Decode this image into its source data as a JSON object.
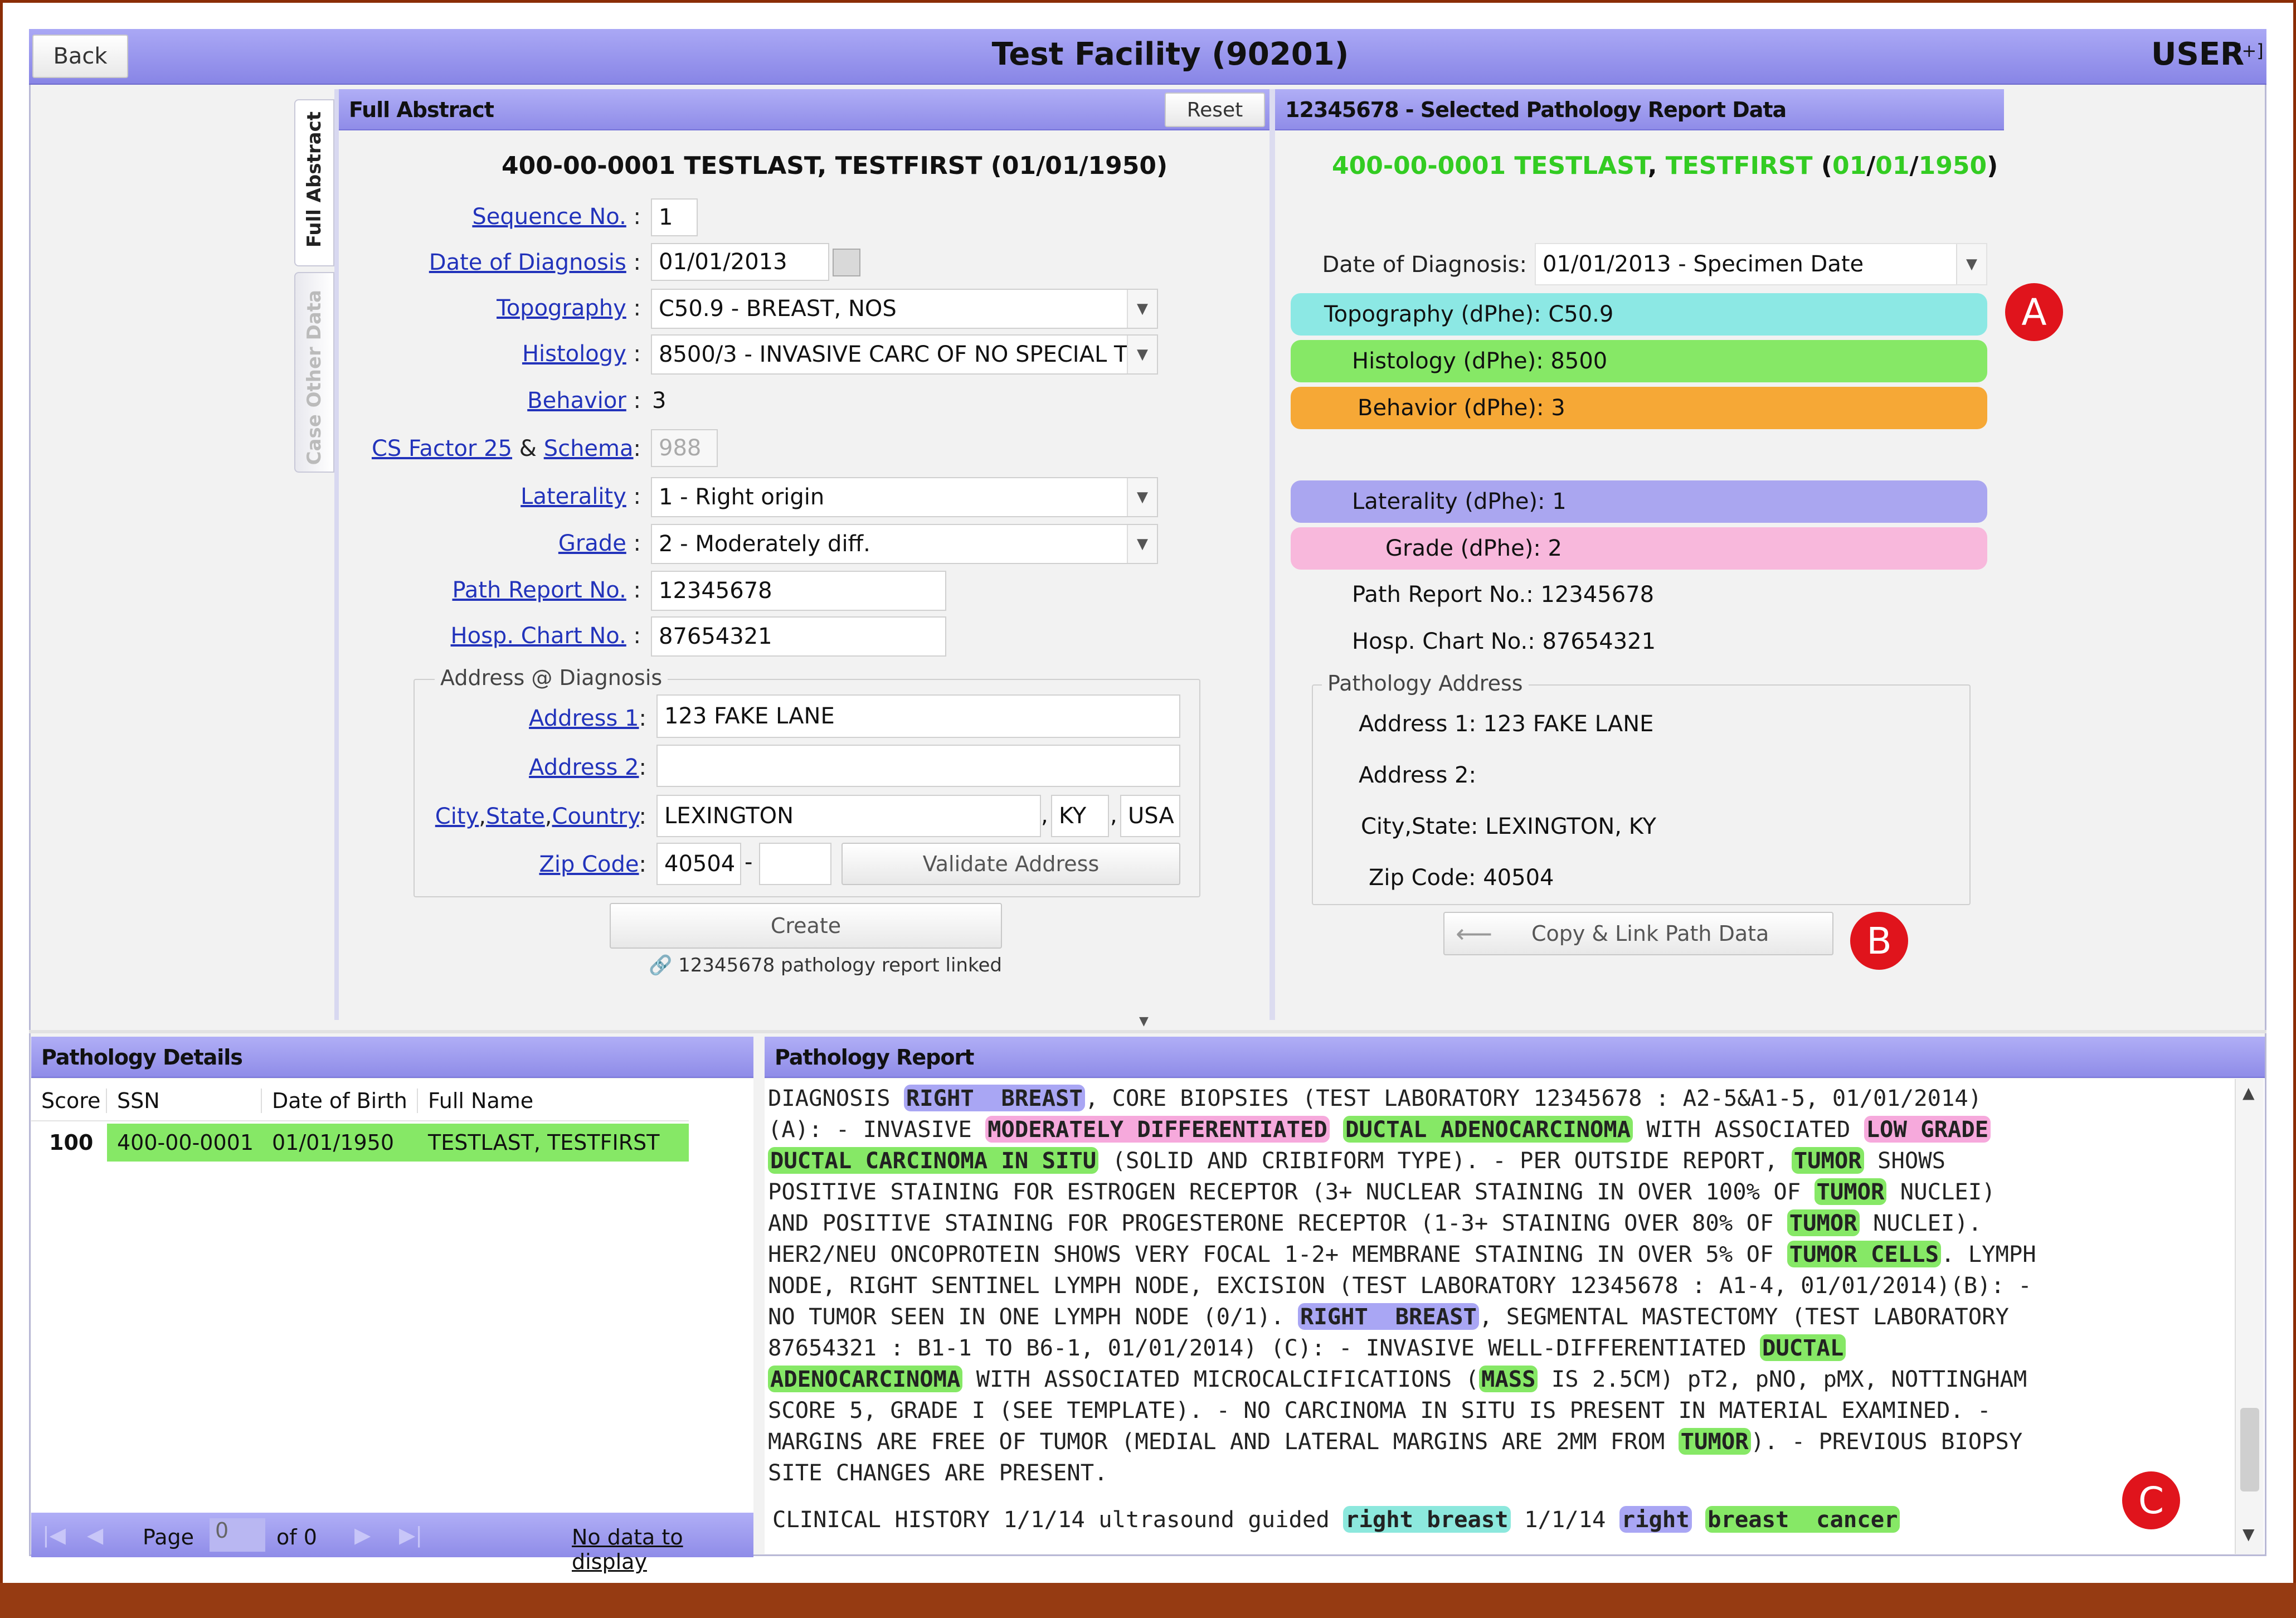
{
  "header": {
    "back_label": "Back",
    "title": "Test Facility (90201)",
    "user_label": "USER",
    "user_expand": "[+]"
  },
  "side_tabs": {
    "full_abstract": "Full Abstract",
    "case_other": "Case Other Data"
  },
  "abstract": {
    "title": "Full Abstract",
    "reset_label": "Reset",
    "patient": "400-00-0001 TESTLAST, TESTFIRST (01/01/1950)",
    "sequence_label": "Sequence No.",
    "sequence_value": "1",
    "dod_label": "Date of Diagnosis",
    "dod_value": "01/01/2013",
    "topo_label": "Topography",
    "topo_value": "C50.9 - BREAST, NOS",
    "hist_label": "Histology",
    "hist_value": "8500/3 - INVASIVE CARC OF NO SPECIAL T",
    "beh_label": "Behavior",
    "beh_value": "3",
    "csf_label": "CS Factor 25",
    "amp": "&",
    "schema_label": "Schema",
    "csf_value": "988",
    "lat_label": "Laterality",
    "lat_value": "1 - Right origin",
    "grade_label": "Grade",
    "grade_value": "2 - Moderately diff.",
    "path_label": "Path Report No.",
    "path_value": "12345678",
    "chart_label": "Hosp. Chart No.",
    "chart_value": "87654321",
    "addr_group": "Address @ Diagnosis",
    "addr1_label": "Address 1",
    "addr1_value": "123 FAKE LANE",
    "addr2_label": "Address 2",
    "addr2_value": "",
    "city_label_city": "City",
    "city_label_state": "State",
    "city_label_country": "Country",
    "city_value": "LEXINGTON",
    "state_value": "KY",
    "country_value": "USA",
    "zip_label": "Zip Code",
    "zip_value": "40504",
    "zip_ext": "",
    "validate_label": "Validate Address",
    "create_label": "Create",
    "linked_note": "12345678 pathology report linked",
    "colon": ":",
    "comma": ","
  },
  "selected": {
    "title": "12345678 - Selected Pathology Report Data",
    "id": "400-00-0001",
    "last": "TESTLAST",
    "first": "TESTFIRST",
    "dob_m": "01",
    "dob_d": "01",
    "dob_y": "1950",
    "dod_label": "Date of Diagnosis:",
    "dod_value": "01/01/2013 - Specimen Date",
    "topo": "Topography (dPhe): C50.9",
    "hist": "Histology (dPhe): 8500",
    "beh": "Behavior (dPhe): 3",
    "lat": "Laterality (dPhe): 1",
    "grade": "Grade (dPhe): 2",
    "path": "Path Report No.: 12345678",
    "chart": "Hosp. Chart No.: 87654321",
    "addr_group": "Pathology Address",
    "addr1": "Address 1: 123 FAKE LANE",
    "addr2": "Address 2:",
    "city": "City,State: LEXINGTON, KY",
    "zip": "Zip Code: 40504",
    "copy_label": "Copy & Link Path Data",
    "colors": {
      "cyan": "#8ce8e4",
      "green": "#86e866",
      "orange": "#f6a836",
      "purple": "#aaa6f0",
      "pink": "#f8b8dc"
    }
  },
  "markers": {
    "a": "A",
    "b": "B",
    "c": "C"
  },
  "details": {
    "title": "Pathology Details",
    "columns": [
      "Score",
      "SSN",
      "Date of Birth",
      "Full Name"
    ],
    "row": {
      "score": "100",
      "ssn": "400-00-0001",
      "dob": "01/01/1950",
      "name": "TESTLAST, TESTFIRST"
    },
    "page_label": "Page",
    "page_value": "0",
    "of_label": "of 0",
    "no_data": "No data to display"
  },
  "report": {
    "title": "Pathology Report",
    "segments": [
      [
        "DIAGNOSIS ",
        ""
      ],
      [
        "RIGHT  BREAST",
        "hb"
      ],
      [
        ", CORE BIOPSIES (TEST LABORATORY 12345678 : A2-5&A1-5, 01/01/2014)",
        ""
      ],
      [
        "\n",
        ""
      ],
      [
        "(A): - INVASIVE ",
        ""
      ],
      [
        "MODERATELY DIFFERENTIATED",
        "hp"
      ],
      [
        " ",
        ""
      ],
      [
        "DUCTAL ADENOCARCINOMA",
        "hg"
      ],
      [
        " WITH ASSOCIATED ",
        ""
      ],
      [
        "LOW GRADE",
        "hp"
      ],
      [
        "\n",
        ""
      ],
      [
        "DUCTAL CARCINOMA IN SITU",
        "hg"
      ],
      [
        " (SOLID AND CRIBIFORM TYPE). - PER OUTSIDE REPORT, ",
        ""
      ],
      [
        "TUMOR",
        "hg"
      ],
      [
        " SHOWS",
        ""
      ],
      [
        "\n",
        ""
      ],
      [
        "POSITIVE STAINING FOR ESTROGEN RECEPTOR (3+ NUCLEAR STAINING IN OVER 100% OF ",
        ""
      ],
      [
        "TUMOR",
        "hg"
      ],
      [
        " NUCLEI)",
        ""
      ],
      [
        "\n",
        ""
      ],
      [
        "AND POSITIVE STAINING FOR PROGESTERONE RECEPTOR (1-3+ STAINING OVER 80% OF ",
        ""
      ],
      [
        "TUMOR",
        "hg"
      ],
      [
        " NUCLEI).",
        ""
      ],
      [
        "\n",
        ""
      ],
      [
        "HER2/NEU ONCOPROTEIN SHOWS VERY FOCAL 1-2+ MEMBRANE STAINING IN OVER 5% OF ",
        ""
      ],
      [
        "TUMOR CELLS",
        "hg"
      ],
      [
        ". LYMPH",
        ""
      ],
      [
        "\n",
        ""
      ],
      [
        "NODE, RIGHT SENTINEL LYMPH NODE, EXCISION (TEST LABORATORY 12345678 : A1-4, 01/01/2014)(B): -",
        ""
      ],
      [
        "\n",
        ""
      ],
      [
        "NO TUMOR SEEN IN ONE LYMPH NODE (0/1). ",
        ""
      ],
      [
        "RIGHT  BREAST",
        "hb"
      ],
      [
        ", SEGMENTAL MASTECTOMY (TEST LABORATORY",
        ""
      ],
      [
        "\n",
        ""
      ],
      [
        "87654321 : B1-1 TO B6-1, 01/01/2014) (C): - INVASIVE WELL-DIFFERENTIATED ",
        ""
      ],
      [
        "DUCTAL",
        "hg"
      ],
      [
        "\n",
        ""
      ],
      [
        "ADENOCARCINOMA",
        "hg"
      ],
      [
        " WITH ASSOCIATED MICROCALCIFICATIONS (",
        ""
      ],
      [
        "MASS",
        "hg"
      ],
      [
        " IS 2.5CM) pT2, pNO, pMX, NOTTINGHAM",
        ""
      ],
      [
        "\n",
        ""
      ],
      [
        "SCORE 5, GRADE I (SEE TEMPLATE). - NO CARCINOMA IN SITU IS PRESENT IN MATERIAL EXAMINED. -",
        ""
      ],
      [
        "\n",
        ""
      ],
      [
        "MARGINS ARE FREE OF TUMOR (MEDIAL AND LATERAL MARGINS ARE 2MM FROM ",
        ""
      ],
      [
        "TUMOR",
        "hg"
      ],
      [
        "). - PREVIOUS BIOPSY",
        ""
      ],
      [
        "\n",
        ""
      ],
      [
        "SITE CHANGES ARE PRESENT.",
        ""
      ]
    ],
    "clinical": [
      [
        "CLINICAL HISTORY 1/1/14 ultrasound guided ",
        ""
      ],
      [
        "right breast",
        "hc"
      ],
      [
        " 1/1/14 ",
        ""
      ],
      [
        "right",
        "hb"
      ],
      [
        " ",
        ""
      ],
      [
        "breast  cancer",
        "hg"
      ]
    ]
  }
}
